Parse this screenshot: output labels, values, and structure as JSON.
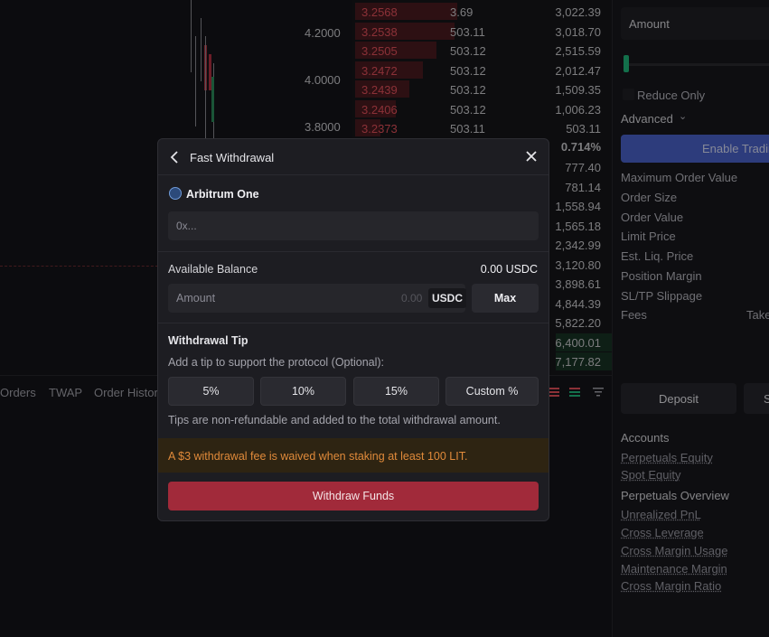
{
  "chart": {
    "y_labels": [
      "4.2000",
      "4.0000",
      "3.8000"
    ]
  },
  "orderbook": {
    "asks": [
      {
        "price": "3.2568",
        "size": "3.69",
        "total": "3,022.39"
      },
      {
        "price": "3.2538",
        "size": "503.11",
        "total": "3,018.70"
      },
      {
        "price": "3.2505",
        "size": "503.12",
        "total": "2,515.59"
      },
      {
        "price": "3.2472",
        "size": "503.12",
        "total": "2,012.47"
      },
      {
        "price": "3.2439",
        "size": "503.12",
        "total": "1,509.35"
      },
      {
        "price": "3.2406",
        "size": "503.12",
        "total": "1,006.23"
      },
      {
        "price": "3.2373",
        "size": "503.11",
        "total": "503.11"
      }
    ],
    "spread": "0.714%",
    "bid_totals": [
      "777.40",
      "781.14",
      "1,558.94",
      "1,565.18",
      "2,342.99",
      "3,120.80",
      "3,898.61",
      "4,844.39",
      "5,822.20",
      "6,400.01",
      "7,177.82"
    ]
  },
  "bottom_tabs": [
    "Orders",
    "TWAP",
    "Order History"
  ],
  "right_panel": {
    "amount_label": "Amount",
    "reduce_only": "Reduce Only",
    "advanced": "Advanced",
    "enable_trading": "Enable Trading",
    "fields": [
      "Maximum Order Value",
      "Order Size",
      "Order Value",
      "Limit Price",
      "Est. Liq. Price",
      "Position Margin",
      "SL/TP Slippage",
      "Fees"
    ],
    "fees_value": "Taker",
    "deposit": "Deposit",
    "second_button": "S",
    "accounts_heading": "Accounts",
    "accounts_links": [
      "Perpetuals Equity",
      "Spot Equity"
    ],
    "overview_heading": "Perpetuals Overview",
    "overview_links": [
      "Unrealized PnL",
      "Cross Leverage",
      "Cross Margin Usage",
      "Maintenance Margin",
      "Cross Margin Ratio"
    ]
  },
  "modal": {
    "title": "Fast Withdrawal",
    "network": "Arbitrum One",
    "address_placeholder": "0x...",
    "balance_label": "Available Balance",
    "balance_value": "0.00 USDC",
    "amount_label": "Amount",
    "amount_value": "0.00",
    "amount_unit": "USDC",
    "max_label": "Max",
    "tip_title": "Withdrawal Tip",
    "tip_description": "Add a tip to support the protocol (Optional):",
    "tip_options": [
      "5%",
      "10%",
      "15%",
      "Custom %"
    ],
    "tip_note": "Tips are non-refundable and added to the total withdrawal amount.",
    "fee_banner": "A $3 withdrawal fee is waived when staking at least 100 LIT.",
    "submit_label": "Withdraw Funds"
  },
  "colors": {
    "ask_red": "#e0505a",
    "bid_green_bg": "#183324",
    "enable_blue": "#4a62c8",
    "withdraw_red": "#a12a3a",
    "warning_orange": "#e08a3a"
  }
}
